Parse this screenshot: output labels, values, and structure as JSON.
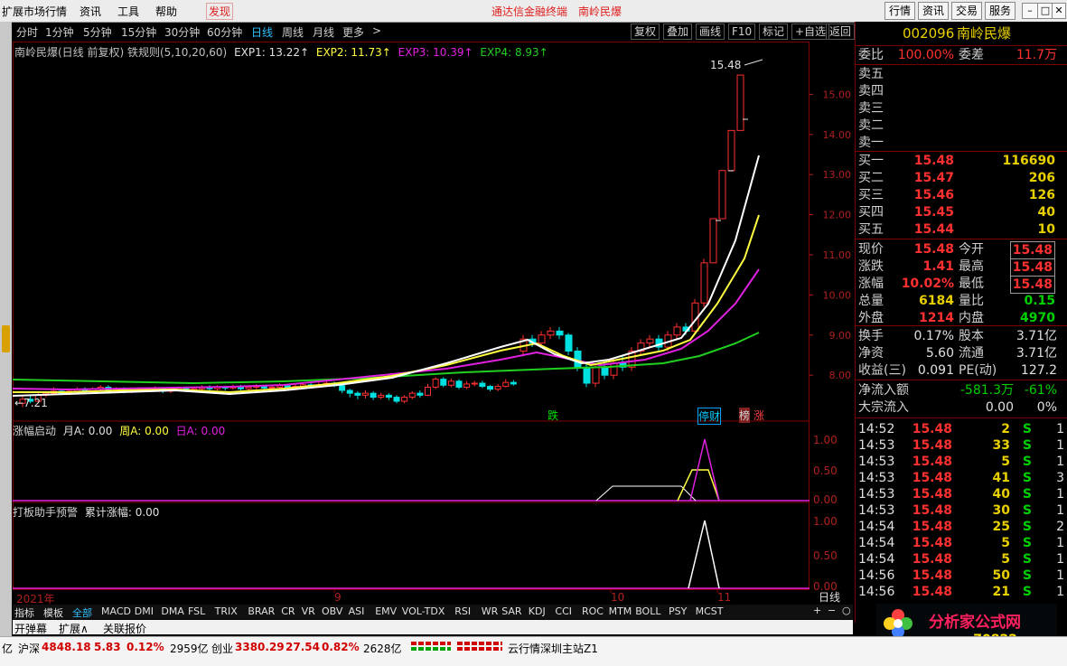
{
  "menu": {
    "items": [
      "扩展市场行情",
      "资讯",
      "工具",
      "帮助",
      "发现"
    ],
    "center_left": "通达信金融终端",
    "center_right": "南岭民爆",
    "right_buttons": [
      "行情",
      "资讯",
      "交易",
      "服务"
    ]
  },
  "periods": [
    "分时",
    "1分钟",
    "5分钟",
    "15分钟",
    "30分钟",
    "60分钟",
    "日线",
    "周线",
    "月线",
    "更多"
  ],
  "active_period": "日线",
  "toolbar": [
    "复权",
    "叠加",
    "画线",
    "F10",
    "标记",
    "+自选",
    "返回"
  ],
  "main_chart": {
    "title": "南岭民爆(日线 前复权) 铁规则(5,10,20,60)",
    "exp1": "EXP1: 13.22↑",
    "exp2": "EXP2: 11.73↑",
    "exp3": "EXP3: 10.39↑",
    "exp4": "EXP4: 8.93↑",
    "high_label": "15.48",
    "low_label": "←7.21",
    "signal_die": "跌",
    "signal_ting": "停财",
    "signal_bang": "榜",
    "signal_zhang": "涨",
    "date_2021": "2021年",
    "date_9": "9",
    "date_10": "10",
    "date_11": "11"
  },
  "chart_data": {
    "type": "line",
    "price_axis": [
      "15.00",
      "14.00",
      "13.00",
      "12.00",
      "11.00",
      "10.00",
      "9.00",
      "8.00"
    ],
    "ylim": [
      6.9,
      16.0
    ],
    "x": [
      0,
      4,
      8,
      12,
      16,
      20,
      24,
      28,
      32,
      36,
      40,
      44,
      48,
      52,
      56,
      60,
      64,
      68,
      72,
      76,
      80,
      84,
      88,
      92,
      96,
      100,
      104,
      108,
      112,
      116,
      120,
      124,
      128,
      132,
      136,
      140,
      144,
      148,
      152,
      156,
      160,
      164,
      168,
      172,
      176,
      180,
      184,
      188,
      192,
      196,
      200,
      204,
      208,
      212,
      216,
      220,
      224,
      228,
      232,
      236,
      240,
      244,
      248,
      252,
      256,
      260,
      264,
      268,
      272,
      276,
      280,
      284,
      288,
      292,
      296,
      300,
      304,
      308,
      312,
      316,
      320,
      324,
      328,
      332,
      336,
      340,
      344,
      348,
      352,
      356,
      360,
      364,
      368,
      372,
      376,
      380,
      384,
      388,
      392,
      396,
      400,
      404,
      408,
      412,
      416,
      420,
      424,
      428,
      432,
      436,
      440,
      444,
      448,
      452,
      456,
      460,
      464,
      468,
      472,
      476,
      480,
      484,
      488,
      492,
      496,
      500,
      504,
      508,
      512,
      516,
      520,
      524,
      528,
      532,
      536,
      540,
      544,
      548,
      552,
      556,
      560,
      564,
      568,
      572,
      576,
      580,
      584,
      588,
      592,
      596,
      600,
      604,
      608,
      612,
      616,
      620,
      624,
      628,
      632,
      636,
      640,
      644,
      648,
      652,
      656,
      660,
      664,
      668,
      672,
      676,
      680,
      684,
      688,
      692,
      696,
      700,
      704,
      708,
      712,
      716,
      720,
      724,
      728,
      732,
      736,
      740,
      744,
      748,
      752,
      756,
      760,
      764,
      768,
      772,
      776,
      780,
      784,
      788,
      792,
      796,
      800,
      804,
      808,
      812,
      816,
      820,
      824,
      828
    ],
    "candles": [
      {
        "o": 7.3,
        "c": 7.4,
        "h": 7.5,
        "l": 7.2
      },
      {
        "o": 7.4,
        "c": 7.35,
        "h": 7.5,
        "l": 7.3
      },
      {
        "o": 7.35,
        "c": 7.5,
        "h": 7.55,
        "l": 7.3
      },
      {
        "o": 7.5,
        "c": 7.55,
        "h": 7.6,
        "l": 7.45
      },
      {
        "o": 7.55,
        "c": 7.6,
        "h": 7.7,
        "l": 7.5
      },
      {
        "o": 7.6,
        "c": 7.55,
        "h": 7.65,
        "l": 7.5
      },
      {
        "o": 7.55,
        "c": 7.6,
        "h": 7.65,
        "l": 7.5
      },
      {
        "o": 7.6,
        "c": 7.65,
        "h": 7.7,
        "l": 7.55
      },
      {
        "o": 7.65,
        "c": 7.6,
        "h": 7.7,
        "l": 7.55
      },
      {
        "o": 7.6,
        "c": 7.65,
        "h": 7.7,
        "l": 7.55
      },
      {
        "o": 7.65,
        "c": 7.7,
        "h": 7.75,
        "l": 7.6
      },
      {
        "o": 7.7,
        "c": 7.6,
        "h": 7.75,
        "l": 7.55
      },
      {
        "o": 7.6,
        "c": 7.65,
        "h": 7.7,
        "l": 7.55
      },
      {
        "o": 7.65,
        "c": 7.6,
        "h": 7.7,
        "l": 7.55
      },
      {
        "o": 7.6,
        "c": 7.62,
        "h": 7.68,
        "l": 7.55
      },
      {
        "o": 7.62,
        "c": 7.65,
        "h": 7.7,
        "l": 7.58
      },
      {
        "o": 7.65,
        "c": 7.62,
        "h": 7.7,
        "l": 7.58
      },
      {
        "o": 7.62,
        "c": 7.66,
        "h": 7.72,
        "l": 7.58
      },
      {
        "o": 7.66,
        "c": 7.6,
        "h": 7.7,
        "l": 7.55
      },
      {
        "o": 7.6,
        "c": 7.64,
        "h": 7.7,
        "l": 7.55
      },
      {
        "o": 7.64,
        "c": 7.68,
        "h": 7.72,
        "l": 7.6
      },
      {
        "o": 7.68,
        "c": 7.62,
        "h": 7.72,
        "l": 7.58
      },
      {
        "o": 7.62,
        "c": 7.66,
        "h": 7.7,
        "l": 7.58
      },
      {
        "o": 7.66,
        "c": 7.7,
        "h": 7.75,
        "l": 7.62
      },
      {
        "o": 7.7,
        "c": 7.66,
        "h": 7.75,
        "l": 7.62
      },
      {
        "o": 7.66,
        "c": 7.7,
        "h": 7.75,
        "l": 7.62
      },
      {
        "o": 7.7,
        "c": 7.68,
        "h": 7.74,
        "l": 7.62
      },
      {
        "o": 7.68,
        "c": 7.72,
        "h": 7.76,
        "l": 7.64
      },
      {
        "o": 7.72,
        "c": 7.66,
        "h": 7.76,
        "l": 7.62
      },
      {
        "o": 7.66,
        "c": 7.7,
        "h": 7.74,
        "l": 7.62
      },
      {
        "o": 7.7,
        "c": 7.72,
        "h": 7.78,
        "l": 7.65
      },
      {
        "o": 7.72,
        "c": 7.68,
        "h": 7.76,
        "l": 7.64
      },
      {
        "o": 7.68,
        "c": 7.7,
        "h": 7.75,
        "l": 7.62
      },
      {
        "o": 7.7,
        "c": 7.74,
        "h": 7.8,
        "l": 7.66
      },
      {
        "o": 7.74,
        "c": 7.7,
        "h": 7.78,
        "l": 7.66
      },
      {
        "o": 7.7,
        "c": 7.72,
        "h": 7.78,
        "l": 7.66
      },
      {
        "o": 7.72,
        "c": 7.76,
        "h": 7.82,
        "l": 7.68
      },
      {
        "o": 7.76,
        "c": 7.72,
        "h": 7.8,
        "l": 7.68
      },
      {
        "o": 7.72,
        "c": 7.76,
        "h": 7.82,
        "l": 7.68
      },
      {
        "o": 7.76,
        "c": 7.8,
        "h": 7.86,
        "l": 7.72
      },
      {
        "o": 7.8,
        "c": 7.74,
        "h": 7.84,
        "l": 7.7
      },
      {
        "o": 7.74,
        "c": 7.62,
        "h": 7.78,
        "l": 7.55
      },
      {
        "o": 7.62,
        "c": 7.55,
        "h": 7.66,
        "l": 7.45
      },
      {
        "o": 7.55,
        "c": 7.5,
        "h": 7.6,
        "l": 7.4
      },
      {
        "o": 7.5,
        "c": 7.55,
        "h": 7.62,
        "l": 7.42
      },
      {
        "o": 7.55,
        "c": 7.45,
        "h": 7.6,
        "l": 7.38
      },
      {
        "o": 7.45,
        "c": 7.5,
        "h": 7.56,
        "l": 7.4
      },
      {
        "o": 7.5,
        "c": 7.45,
        "h": 7.55,
        "l": 7.38
      },
      {
        "o": 7.45,
        "c": 7.35,
        "h": 7.5,
        "l": 7.3
      },
      {
        "o": 7.35,
        "c": 7.45,
        "h": 7.5,
        "l": 7.3
      },
      {
        "o": 7.45,
        "c": 7.55,
        "h": 7.6,
        "l": 7.4
      },
      {
        "o": 7.55,
        "c": 7.5,
        "h": 7.62,
        "l": 7.44
      },
      {
        "o": 7.5,
        "c": 7.7,
        "h": 7.78,
        "l": 7.48
      },
      {
        "o": 7.7,
        "c": 7.9,
        "h": 7.95,
        "l": 7.65
      },
      {
        "o": 7.9,
        "c": 7.75,
        "h": 7.95,
        "l": 7.7
      },
      {
        "o": 7.75,
        "c": 7.85,
        "h": 7.92,
        "l": 7.7
      },
      {
        "o": 7.85,
        "c": 7.7,
        "h": 7.9,
        "l": 7.65
      },
      {
        "o": 7.7,
        "c": 7.78,
        "h": 7.85,
        "l": 7.65
      },
      {
        "o": 7.78,
        "c": 7.8,
        "h": 7.86,
        "l": 7.72
      },
      {
        "o": 7.8,
        "c": 7.72,
        "h": 7.86,
        "l": 7.68
      },
      {
        "o": 7.72,
        "c": 7.65,
        "h": 7.76,
        "l": 7.6
      },
      {
        "o": 7.65,
        "c": 7.72,
        "h": 7.78,
        "l": 7.6
      },
      {
        "o": 7.72,
        "c": 7.82,
        "h": 7.9,
        "l": 7.7
      },
      {
        "o": 7.82,
        "c": 7.78,
        "h": 7.88,
        "l": 7.74
      }
    ],
    "bottom1": {
      "label": "涨幅启动",
      "yue": "月A: 0.00",
      "zhou": "周A: 0.00",
      "ri": "日A: 0.00",
      "ticks": [
        "1.00",
        "0.50",
        "0.00"
      ]
    },
    "bottom2": {
      "label": "打板助手预警",
      "leiji": "累计涨幅: 0.00",
      "ticks": [
        "1.00",
        "0.50",
        "0.00"
      ]
    }
  },
  "right_panel": {
    "code": "002096",
    "name": "南岭民爆",
    "weibi_label": "委比",
    "weibi": "100.00%",
    "weicha_label": "委差",
    "weicha": "11.7万",
    "sells": [
      "卖五",
      "卖四",
      "卖三",
      "卖二",
      "卖一"
    ],
    "buys": [
      {
        "label": "买一",
        "price": "15.48",
        "vol": "116690"
      },
      {
        "label": "买二",
        "price": "15.47",
        "vol": "206"
      },
      {
        "label": "买三",
        "price": "15.46",
        "vol": "126"
      },
      {
        "label": "买四",
        "price": "15.45",
        "vol": "40"
      },
      {
        "label": "买五",
        "price": "15.44",
        "vol": "10"
      }
    ],
    "stats": [
      {
        "k1": "现价",
        "v1": "15.48",
        "k2": "今开",
        "v2": "15.48"
      },
      {
        "k1": "涨跌",
        "v1": "1.41",
        "k2": "最高",
        "v2": "15.48"
      },
      {
        "k1": "涨幅",
        "v1": "10.02%",
        "k2": "最低",
        "v2": "15.48"
      },
      {
        "k1": "总量",
        "v1": "6184",
        "k2": "量比",
        "v2": "0.15"
      },
      {
        "k1": "外盘",
        "v1": "1214",
        "k2": "内盘",
        "v2": "4970"
      }
    ],
    "stats2": [
      {
        "k1": "换手",
        "v1": "0.17%",
        "k2": "股本",
        "v2": "3.71亿"
      },
      {
        "k1": "净资",
        "v1": "5.60",
        "k2": "流通",
        "v2": "3.71亿"
      },
      {
        "k1": "收益(三)",
        "v1": "0.091",
        "k2": "PE(动)",
        "v2": "127.2"
      }
    ],
    "flow": [
      {
        "k": "净流入额",
        "v1": "-581.3万",
        "v2": "-61%"
      },
      {
        "k": "大宗流入",
        "v1": "0.00",
        "v2": "0%"
      }
    ],
    "ticks": [
      {
        "t": "14:52",
        "p": "15.48",
        "v": "2",
        "s": "S",
        "n": "1"
      },
      {
        "t": "14:53",
        "p": "15.48",
        "v": "33",
        "s": "S",
        "n": "1"
      },
      {
        "t": "14:53",
        "p": "15.48",
        "v": "5",
        "s": "S",
        "n": "1"
      },
      {
        "t": "14:53",
        "p": "15.48",
        "v": "41",
        "s": "S",
        "n": "3"
      },
      {
        "t": "14:53",
        "p": "15.48",
        "v": "40",
        "s": "S",
        "n": "1"
      },
      {
        "t": "14:53",
        "p": "15.48",
        "v": "30",
        "s": "S",
        "n": "1"
      },
      {
        "t": "14:54",
        "p": "15.48",
        "v": "25",
        "s": "S",
        "n": "2"
      },
      {
        "t": "14:54",
        "p": "15.48",
        "v": "5",
        "s": "S",
        "n": "1"
      },
      {
        "t": "14:54",
        "p": "15.48",
        "v": "5",
        "s": "S",
        "n": "1"
      },
      {
        "t": "14:56",
        "p": "15.48",
        "v": "50",
        "s": "S",
        "n": "1"
      },
      {
        "t": "14:56",
        "p": "15.48",
        "v": "21",
        "s": "S",
        "n": "1"
      }
    ],
    "daily": "日线"
  },
  "tabs": [
    "指标",
    "模板",
    "全部",
    "MACD",
    "DMI",
    "DMA",
    "FSL",
    "TRIX",
    "BRAR",
    "CR",
    "VR",
    "OBV",
    "ASI",
    "EMV",
    "VOL-TDX",
    "RSI",
    "WR",
    "SAR",
    "KDJ",
    "CCI",
    "ROC",
    "MTM",
    "BOLL",
    "PSY",
    "MCST"
  ],
  "tabs2": [
    "开弹幕",
    "扩展∧",
    "关联报价"
  ],
  "status": {
    "shenzhen_label": "沪深",
    "shenzhen_val": "4848.18",
    "sz_chg": "5.83",
    "sz_pct": "0.12%",
    "sz_amt": "2959亿",
    "cy_label": "创业",
    "cy_val": "3380.29",
    "cy_chg": "27.54",
    "cy_pct": "0.82%",
    "cy_amt": "2628亿",
    "server": "云行情深圳主站Z1",
    "yi": "亿"
  },
  "logo": {
    "text": "分析家公式网",
    "url": "www.70822.com"
  }
}
